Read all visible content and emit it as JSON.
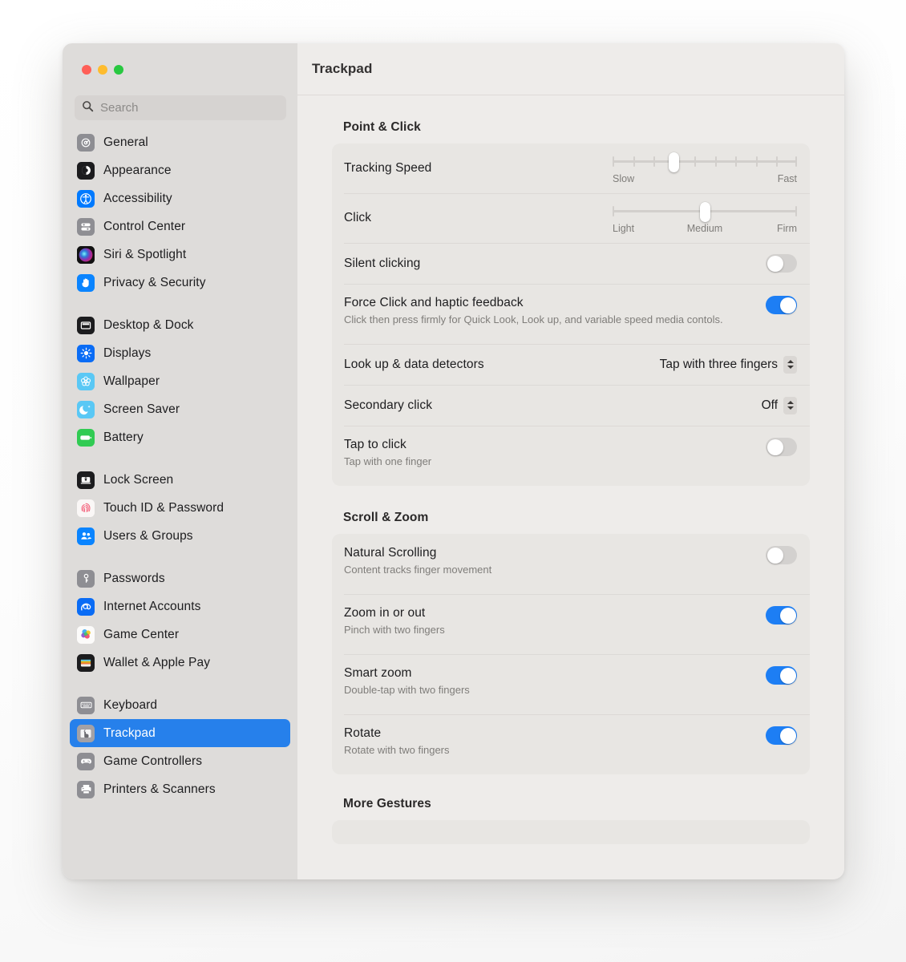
{
  "window": {
    "title": "Trackpad",
    "traffic_lights": [
      "close",
      "minimize",
      "maximize"
    ],
    "colors": {
      "accent": "#1d7ef4",
      "selected_sidebar": "#2680eb",
      "sidebar_bg": "#dedcda",
      "main_bg": "#eeecea",
      "card_bg": "#e8e6e3"
    }
  },
  "search": {
    "placeholder": "Search",
    "value": "",
    "icon": "search-icon"
  },
  "sidebar": {
    "groups": [
      {
        "items": [
          {
            "label": "General",
            "icon": "gear-icon"
          },
          {
            "label": "Appearance",
            "icon": "appearance-contrast-icon"
          },
          {
            "label": "Accessibility",
            "icon": "accessibility-person-icon"
          },
          {
            "label": "Control Center",
            "icon": "control-center-sliders-icon"
          },
          {
            "label": "Siri & Spotlight",
            "icon": "siri-orb-icon"
          },
          {
            "label": "Privacy & Security",
            "icon": "privacy-hand-icon"
          }
        ]
      },
      {
        "items": [
          {
            "label": "Desktop & Dock",
            "icon": "desktop-dock-icon"
          },
          {
            "label": "Displays",
            "icon": "brightness-sun-icon"
          },
          {
            "label": "Wallpaper",
            "icon": "wallpaper-flower-icon"
          },
          {
            "label": "Screen Saver",
            "icon": "moon-stars-icon"
          },
          {
            "label": "Battery",
            "icon": "battery-icon"
          }
        ]
      },
      {
        "items": [
          {
            "label": "Lock Screen",
            "icon": "lock-screen-laptop-icon"
          },
          {
            "label": "Touch ID & Password",
            "icon": "fingerprint-icon"
          },
          {
            "label": "Users & Groups",
            "icon": "users-group-icon"
          }
        ]
      },
      {
        "items": [
          {
            "label": "Passwords",
            "icon": "key-icon"
          },
          {
            "label": "Internet Accounts",
            "icon": "at-sign-icon"
          },
          {
            "label": "Game Center",
            "icon": "game-center-balloons-icon"
          },
          {
            "label": "Wallet & Apple Pay",
            "icon": "wallet-card-icon"
          }
        ]
      },
      {
        "items": [
          {
            "label": "Keyboard",
            "icon": "keyboard-icon"
          },
          {
            "label": "Trackpad",
            "icon": "trackpad-hand-icon",
            "selected": true
          },
          {
            "label": "Game Controllers",
            "icon": "gamepad-icon"
          },
          {
            "label": "Printers & Scanners",
            "icon": "printer-icon"
          }
        ]
      }
    ]
  },
  "sections": [
    {
      "heading": "Point & Click",
      "rows": [
        {
          "kind": "slider",
          "title": "Tracking Speed",
          "slider": {
            "ticks": 10,
            "value_index": 3,
            "label_left": "Slow",
            "label_mid": "",
            "label_right": "Fast"
          }
        },
        {
          "kind": "slider",
          "title": "Click",
          "slider": {
            "ticks": 2,
            "value_index": 1,
            "value_fraction": 0.5,
            "label_left": "Light",
            "label_mid": "Medium",
            "label_right": "Firm"
          }
        },
        {
          "kind": "toggle",
          "title": "Silent clicking",
          "sub": "",
          "on": false
        },
        {
          "kind": "toggle",
          "title": "Force Click and haptic feedback",
          "sub": "Click then press firmly for Quick Look, Look up, and variable speed media contols.",
          "on": true
        },
        {
          "kind": "popup",
          "title": "Look up & data detectors",
          "value": "Tap with three fingers"
        },
        {
          "kind": "popup",
          "title": "Secondary click",
          "value": "Off"
        },
        {
          "kind": "toggle",
          "title": "Tap to click",
          "sub": "Tap with one finger",
          "on": false
        }
      ]
    },
    {
      "heading": "Scroll & Zoom",
      "rows": [
        {
          "kind": "toggle",
          "title": "Natural Scrolling",
          "sub": "Content tracks finger movement",
          "on": false
        },
        {
          "kind": "toggle",
          "title": "Zoom in or out",
          "sub": "Pinch with two fingers",
          "on": true
        },
        {
          "kind": "toggle",
          "title": "Smart zoom",
          "sub": "Double-tap with two fingers",
          "on": true
        },
        {
          "kind": "toggle",
          "title": "Rotate",
          "sub": "Rotate with two fingers",
          "on": true
        }
      ]
    },
    {
      "heading": "More Gestures",
      "rows": [],
      "clipped": true
    }
  ]
}
